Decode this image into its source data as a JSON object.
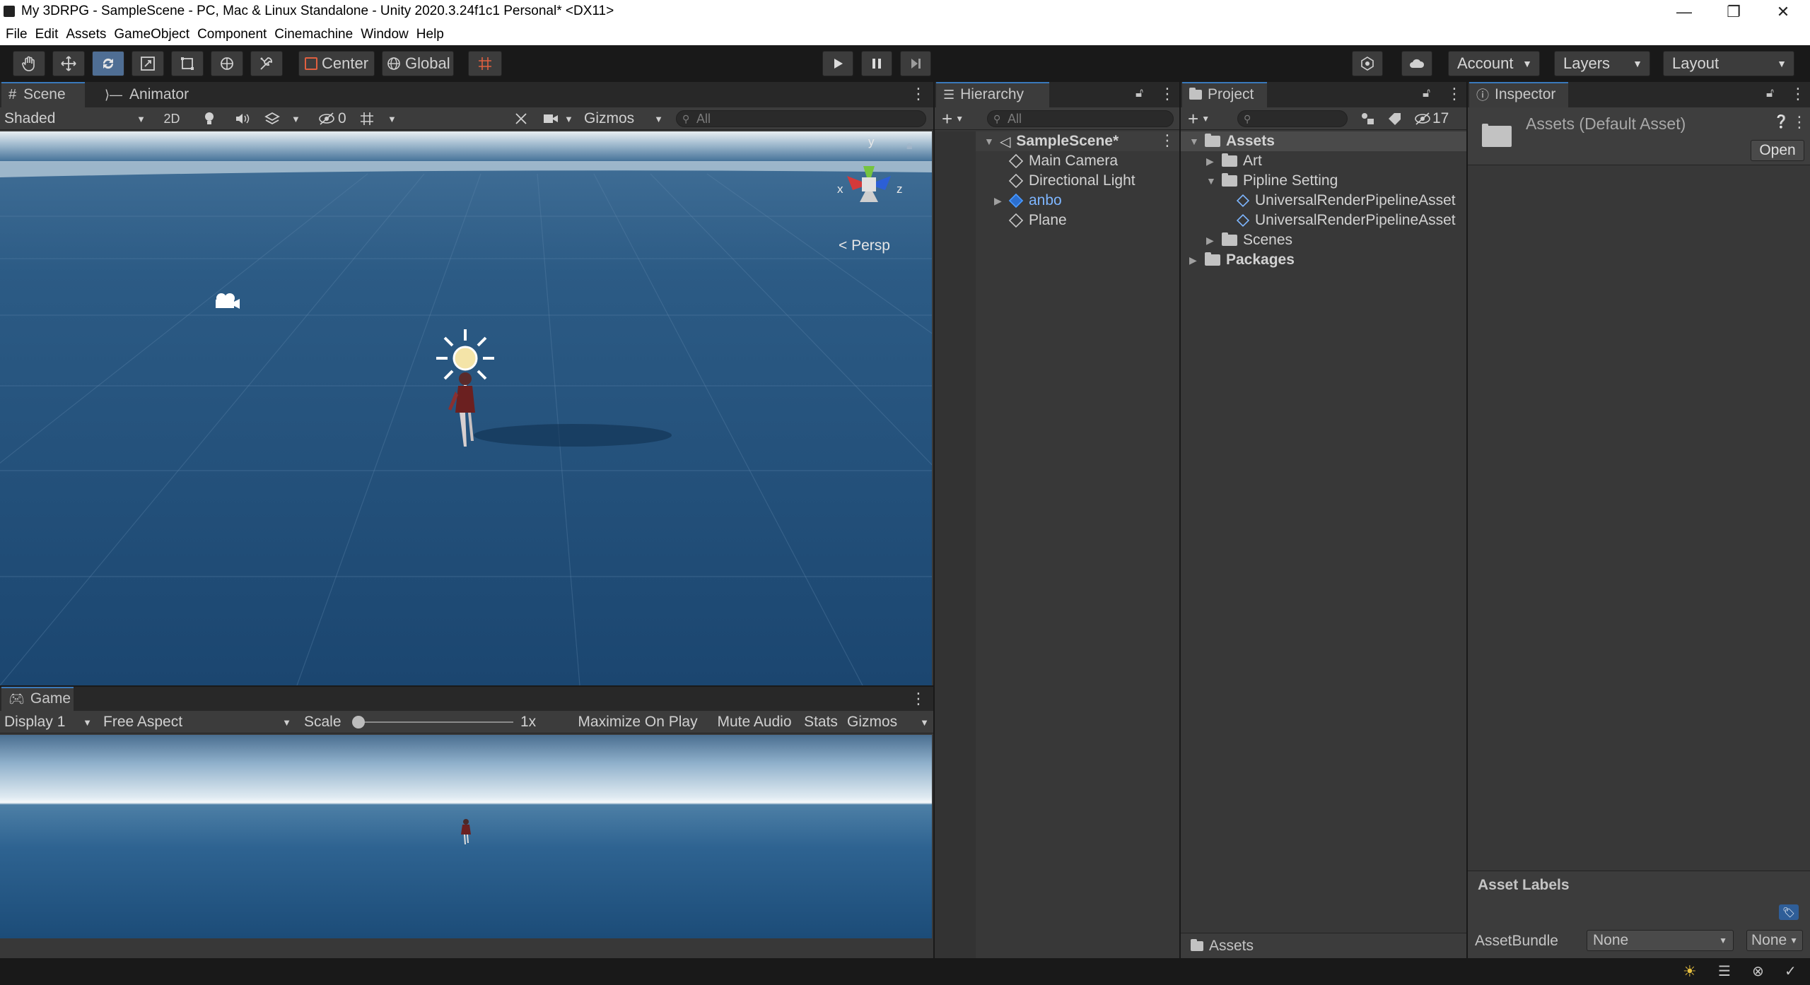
{
  "window": {
    "title": "My 3DRPG - SampleScene - PC, Mac & Linux Standalone - Unity 2020.3.24f1c1 Personal* <DX11>",
    "min_icon": "—",
    "max_icon": "❐",
    "close_icon": "✕"
  },
  "menu": [
    "File",
    "Edit",
    "Assets",
    "GameObject",
    "Component",
    "Cinemachine",
    "Window",
    "Help"
  ],
  "toolbar": {
    "center_label": "Center",
    "global_label": "Global",
    "account_label": "Account",
    "layers_label": "Layers",
    "layout_label": "Layout"
  },
  "scene_panel": {
    "tabs": [
      "Scene",
      "Animator"
    ],
    "shading_mode": "Shaded",
    "mode_2d": "2D",
    "hidden_count": "0",
    "gizmos_label": "Gizmos",
    "search_placeholder": "All",
    "persp_label": "Persp",
    "axis_x": "x",
    "axis_y": "y",
    "axis_z": "z"
  },
  "game_panel": {
    "tab": "Game",
    "display": "Display 1",
    "aspect": "Free Aspect",
    "scale_label": "Scale",
    "scale_value": "1x",
    "scale_level": 0,
    "maximize_label": "Maximize On Play",
    "mute_label": "Mute Audio",
    "stats_label": "Stats",
    "gizmos_label": "Gizmos"
  },
  "hierarchy": {
    "tab": "Hierarchy",
    "search_placeholder": "All",
    "scene": "SampleScene*",
    "items": [
      "Main Camera",
      "Directional Light",
      "anbo",
      "Plane"
    ]
  },
  "project": {
    "tab": "Project",
    "hidden_count": "17",
    "tree": {
      "assets": "Assets",
      "art": "Art",
      "pipline": "Pipline Setting",
      "urp1": "UniversalRenderPipelineAsset",
      "urp2": "UniversalRenderPipelineAsset",
      "scenes": "Scenes",
      "packages": "Packages"
    },
    "footer_path": "Assets"
  },
  "inspector": {
    "tab": "Inspector",
    "asset_title": "Assets (Default Asset)",
    "open_label": "Open",
    "asset_labels_title": "Asset Labels",
    "assetbundle_label": "AssetBundle",
    "bundle_value": "None",
    "variant_value": "None"
  },
  "colors": {
    "accent": "#3a79bb",
    "panel_bg": "#383838",
    "prefab_blue": "#7eb6ff"
  }
}
